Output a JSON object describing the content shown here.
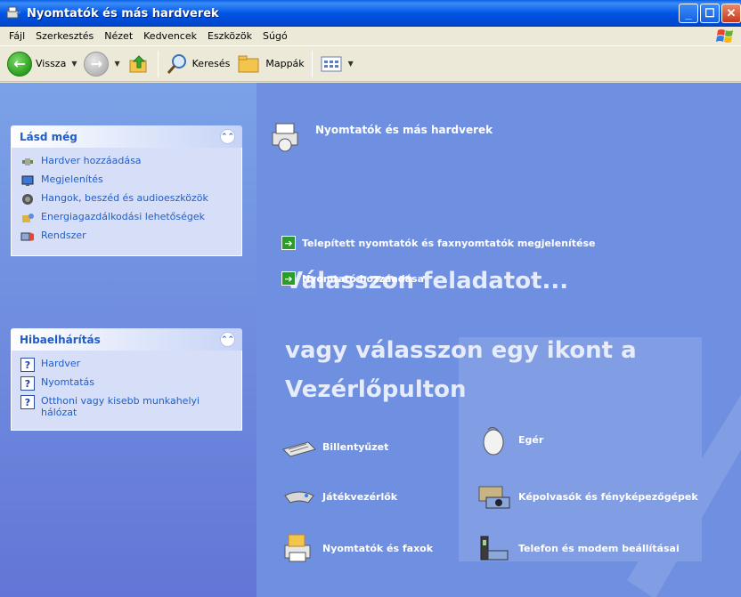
{
  "window": {
    "title": "Nyomtatók és más hardverek"
  },
  "menu": {
    "items": [
      "Fájl",
      "Szerkesztés",
      "Nézet",
      "Kedvencek",
      "Eszközök",
      "Súgó"
    ]
  },
  "toolbar": {
    "back": "Vissza",
    "search": "Keresés",
    "folders": "Mappák"
  },
  "see_also": {
    "title": "Lásd még",
    "items": [
      "Hardver hozzáadása",
      "Megjelenítés",
      "Hangok, beszéd és audioeszközök",
      "Energiagazdálkodási lehetőségek",
      "Rendszer"
    ]
  },
  "troubleshoot": {
    "title": "Hibaelhárítás",
    "items": [
      "Hardver",
      "Nyomtatás",
      "Otthoni vagy kisebb munkahelyi hálózat"
    ]
  },
  "content": {
    "header": "Nyomtatók és más hardverek",
    "pick_task": "Válasszon feladatot...",
    "tasks": [
      "Telepített nyomtatók és faxnyomtatók megjelenítése",
      "Nyomtató hozzáadása"
    ],
    "pick_icon_line1": "vagy válasszon egy ikont a",
    "pick_icon_line2": "Vezérlőpulton",
    "icons": [
      "Billentyűzet",
      "Egér",
      "Játékvezérlők",
      "Képolvasók és fényképezőgépek",
      "Nyomtatók és faxok",
      "Telefon és modem beállításai"
    ]
  }
}
